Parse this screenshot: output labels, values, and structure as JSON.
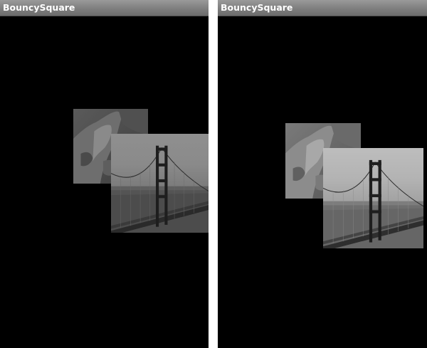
{
  "screens": [
    {
      "id": "left",
      "app_title": "BouncySquare"
    },
    {
      "id": "right",
      "app_title": "BouncySquare"
    }
  ],
  "images": {
    "back": {
      "icon": "rock-cliff-photo"
    },
    "front": {
      "icon": "golden-gate-bridge-photo"
    }
  }
}
